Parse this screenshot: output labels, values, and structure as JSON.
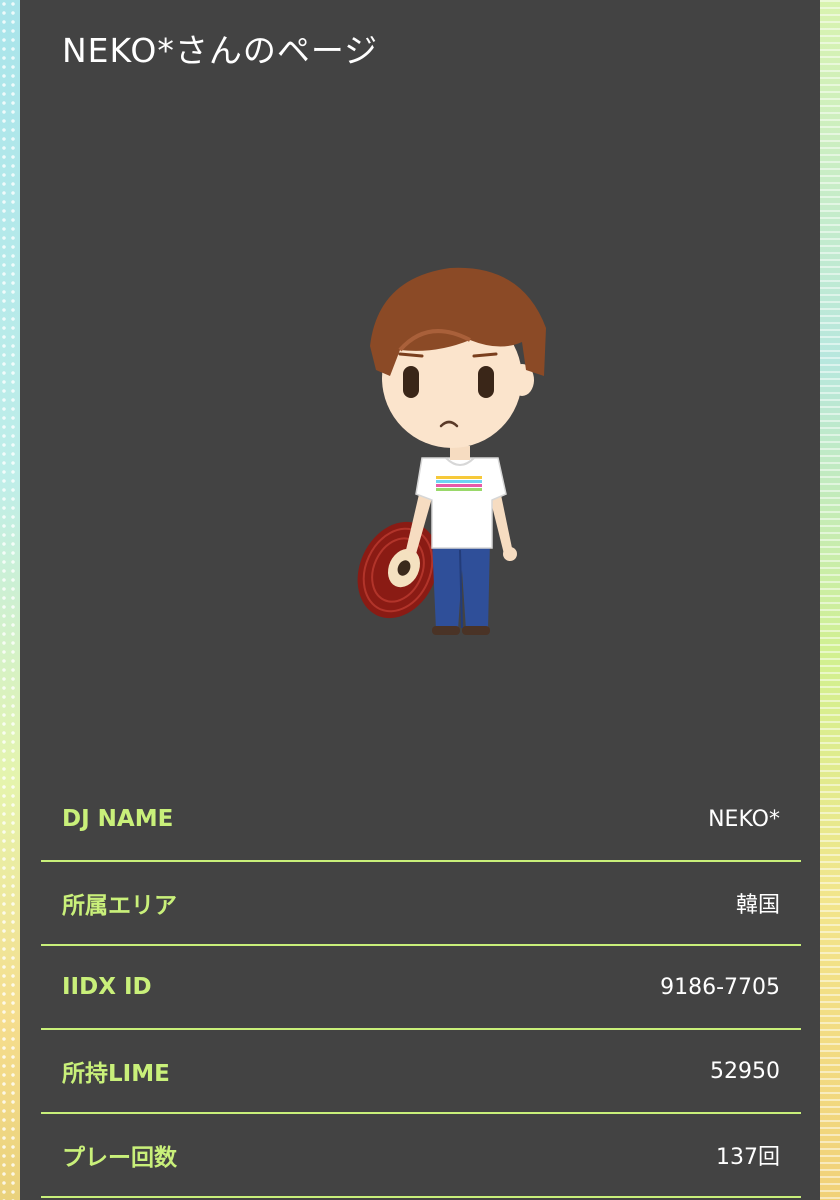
{
  "page": {
    "title": "NEKO*さんのページ"
  },
  "avatar": {
    "icon": "dj-avatar-character"
  },
  "profile": {
    "rows": [
      {
        "label": "DJ NAME",
        "value": "NEKO*"
      },
      {
        "label": "所属エリア",
        "value": "韓国"
      },
      {
        "label": "IIDX ID",
        "value": "9186-7705"
      },
      {
        "label": "所持LIME",
        "value": "52950"
      },
      {
        "label": "プレー回数",
        "value": "137回"
      }
    ]
  },
  "colors": {
    "panel_bg": "#434343",
    "label_accent": "#c9f07a",
    "text": "#ffffff"
  }
}
